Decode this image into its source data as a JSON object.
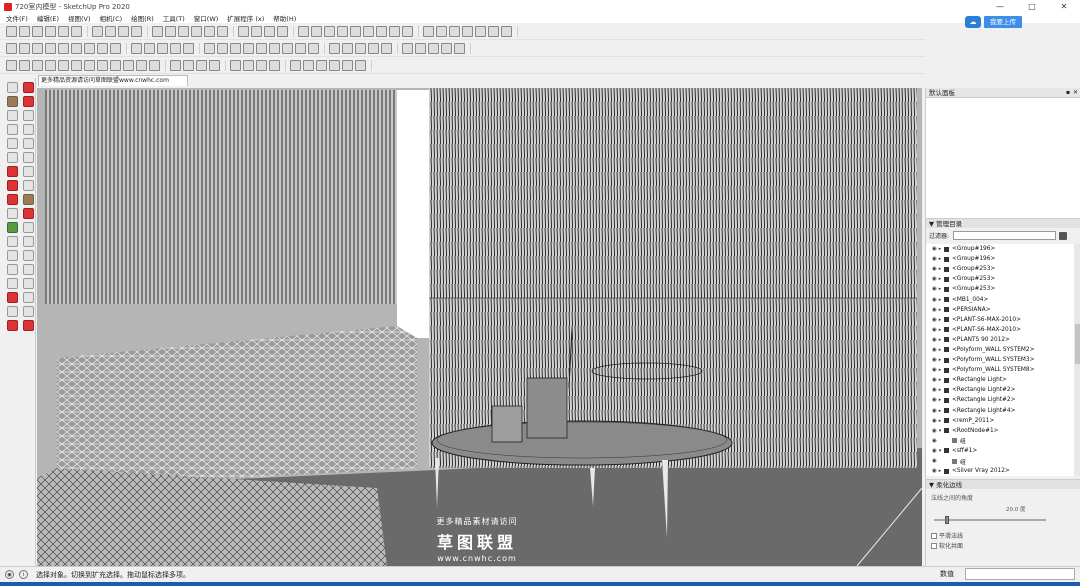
{
  "window": {
    "title": "720室内模型 - SketchUp Pro 2020",
    "controls": [
      "—",
      "□",
      "✕"
    ]
  },
  "menu": [
    "文件(F)",
    "编辑(E)",
    "视图(V)",
    "相机(C)",
    "绘图(R)",
    "工具(T)",
    "窗口(W)",
    "扩展程序 (x)",
    "帮助(H)"
  ],
  "login": {
    "label": "我要上传"
  },
  "scene_tab": "更多精品资源请访问草图联盟www.cnwhc.com",
  "right_panel": {
    "tray_title": "默认面板",
    "outliner": {
      "title": "▼ 管理目录",
      "filter_label": "过滤器:",
      "items": [
        "<Group#196>",
        "<Group#196>",
        "<Group#253>",
        "<Group#253>",
        "<Group#253>",
        "<MB1_004>",
        "<PERSIANA>",
        "<PLANT-S6-MAX-2010>",
        "<PLANT-S6-MAX-2010>",
        "<PLANTS 90 2012>",
        "<Polyform_WALL SYSTEM2>",
        "<Polyform_WALL SYSTEM3>",
        "<Polyform_WALL SYSTEM8>",
        "<Rectangle Light>",
        "<Rectangle Light#2>",
        "<Rectangle Light#2>",
        "<Rectangle Light#4>",
        "<remP_2011>",
        "<RootNode#1>",
        "组",
        "<sff#1>",
        "组",
        "<Silver Vray 2012>"
      ]
    },
    "soften": {
      "title": "▼ 柔化边线",
      "angle_label": "法线之间的角度",
      "angle_value": "20.0 度",
      "angle_fraction": 0.1,
      "smooth_normals": "平滑法线",
      "soften_coplanar": "软化共面"
    }
  },
  "status": {
    "text": "选择对象。切换到扩充选择。拖动鼠标选择多项。",
    "measurements_label": "数值"
  },
  "watermark": {
    "line1": "更多精品素材请访问",
    "line2": "草图联盟",
    "line3": "www.cnwhc.com"
  },
  "colors": {
    "viewport_bg": "#b5b5b5",
    "floor": "#6a6a6a",
    "login_btn": "#3d8ee6",
    "taskbar": "#1c5ca8"
  }
}
